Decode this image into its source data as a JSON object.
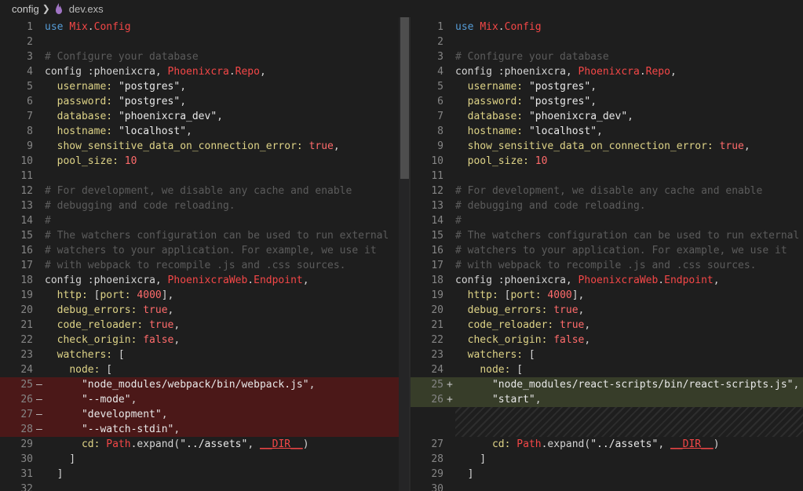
{
  "breadcrumb": {
    "folder": "config",
    "file": "dev.exs"
  },
  "left_lines": [
    {
      "n": "1",
      "m": "",
      "t": "use Mix.Config"
    },
    {
      "n": "2",
      "m": "",
      "t": ""
    },
    {
      "n": "3",
      "m": "",
      "t": "# Configure your database"
    },
    {
      "n": "4",
      "m": "",
      "t": "config :phoenixcra, Phoenixcra.Repo,"
    },
    {
      "n": "5",
      "m": "",
      "t": "  username: \"postgres\","
    },
    {
      "n": "6",
      "m": "",
      "t": "  password: \"postgres\","
    },
    {
      "n": "7",
      "m": "",
      "t": "  database: \"phoenixcra_dev\","
    },
    {
      "n": "8",
      "m": "",
      "t": "  hostname: \"localhost\","
    },
    {
      "n": "9",
      "m": "",
      "t": "  show_sensitive_data_on_connection_error: true,"
    },
    {
      "n": "10",
      "m": "",
      "t": "  pool_size: 10"
    },
    {
      "n": "11",
      "m": "",
      "t": ""
    },
    {
      "n": "12",
      "m": "",
      "t": "# For development, we disable any cache and enable"
    },
    {
      "n": "13",
      "m": "",
      "t": "# debugging and code reloading."
    },
    {
      "n": "14",
      "m": "",
      "t": "#"
    },
    {
      "n": "15",
      "m": "",
      "t": "# The watchers configuration can be used to run external"
    },
    {
      "n": "16",
      "m": "",
      "t": "# watchers to your application. For example, we use it"
    },
    {
      "n": "17",
      "m": "",
      "t": "# with webpack to recompile .js and .css sources."
    },
    {
      "n": "18",
      "m": "",
      "t": "config :phoenixcra, PhoenixcraWeb.Endpoint,"
    },
    {
      "n": "19",
      "m": "",
      "t": "  http: [port: 4000],"
    },
    {
      "n": "20",
      "m": "",
      "t": "  debug_errors: true,"
    },
    {
      "n": "21",
      "m": "",
      "t": "  code_reloader: true,"
    },
    {
      "n": "22",
      "m": "",
      "t": "  check_origin: false,"
    },
    {
      "n": "23",
      "m": "",
      "t": "  watchers: ["
    },
    {
      "n": "24",
      "m": "",
      "t": "    node: ["
    },
    {
      "n": "25",
      "m": "—",
      "t": "      \"node_modules/webpack/bin/webpack.js\","
    },
    {
      "n": "26",
      "m": "—",
      "t": "      \"--mode\","
    },
    {
      "n": "27",
      "m": "—",
      "t": "      \"development\","
    },
    {
      "n": "28",
      "m": "—",
      "t": "      \"--watch-stdin\","
    },
    {
      "n": "29",
      "m": "",
      "t": "      cd: Path.expand(\"../assets\", __DIR__)"
    },
    {
      "n": "30",
      "m": "",
      "t": "    ]"
    },
    {
      "n": "31",
      "m": "",
      "t": "  ]"
    },
    {
      "n": "32",
      "m": "",
      "t": ""
    }
  ],
  "right_lines": [
    {
      "n": "1",
      "m": "",
      "t": "use Mix.Config"
    },
    {
      "n": "2",
      "m": "",
      "t": ""
    },
    {
      "n": "3",
      "m": "",
      "t": "# Configure your database"
    },
    {
      "n": "4",
      "m": "",
      "t": "config :phoenixcra, Phoenixcra.Repo,"
    },
    {
      "n": "5",
      "m": "",
      "t": "  username: \"postgres\","
    },
    {
      "n": "6",
      "m": "",
      "t": "  password: \"postgres\","
    },
    {
      "n": "7",
      "m": "",
      "t": "  database: \"phoenixcra_dev\","
    },
    {
      "n": "8",
      "m": "",
      "t": "  hostname: \"localhost\","
    },
    {
      "n": "9",
      "m": "",
      "t": "  show_sensitive_data_on_connection_error: true,"
    },
    {
      "n": "10",
      "m": "",
      "t": "  pool_size: 10"
    },
    {
      "n": "11",
      "m": "",
      "t": ""
    },
    {
      "n": "12",
      "m": "",
      "t": "# For development, we disable any cache and enable"
    },
    {
      "n": "13",
      "m": "",
      "t": "# debugging and code reloading."
    },
    {
      "n": "14",
      "m": "",
      "t": "#"
    },
    {
      "n": "15",
      "m": "",
      "t": "# The watchers configuration can be used to run external"
    },
    {
      "n": "16",
      "m": "",
      "t": "# watchers to your application. For example, we use it"
    },
    {
      "n": "17",
      "m": "",
      "t": "# with webpack to recompile .js and .css sources."
    },
    {
      "n": "18",
      "m": "",
      "t": "config :phoenixcra, PhoenixcraWeb.Endpoint,"
    },
    {
      "n": "19",
      "m": "",
      "t": "  http: [port: 4000],"
    },
    {
      "n": "20",
      "m": "",
      "t": "  debug_errors: true,"
    },
    {
      "n": "21",
      "m": "",
      "t": "  code_reloader: true,"
    },
    {
      "n": "22",
      "m": "",
      "t": "  check_origin: false,"
    },
    {
      "n": "23",
      "m": "",
      "t": "  watchers: ["
    },
    {
      "n": "24",
      "m": "",
      "t": "    node: ["
    },
    {
      "n": "25",
      "m": "+",
      "t": "      \"node_modules/react-scripts/bin/react-scripts.js\","
    },
    {
      "n": "26",
      "m": "+",
      "t": "      \"start\","
    },
    {
      "n": "",
      "m": "",
      "t": ""
    },
    {
      "n": "",
      "m": "",
      "t": ""
    },
    {
      "n": "27",
      "m": "",
      "t": "      cd: Path.expand(\"../assets\", __DIR__)"
    },
    {
      "n": "28",
      "m": "",
      "t": "    ]"
    },
    {
      "n": "29",
      "m": "",
      "t": "  ]"
    },
    {
      "n": "30",
      "m": "",
      "t": ""
    }
  ],
  "colors": {
    "deleted": "#4b1818",
    "inserted": "#373d29",
    "keyword": "#569cd6",
    "module": "#f44747",
    "comment": "#5c5c5c"
  },
  "icons": {
    "breadcrumb_separator": "chevron-right-icon",
    "file": "elixir-file-icon"
  }
}
